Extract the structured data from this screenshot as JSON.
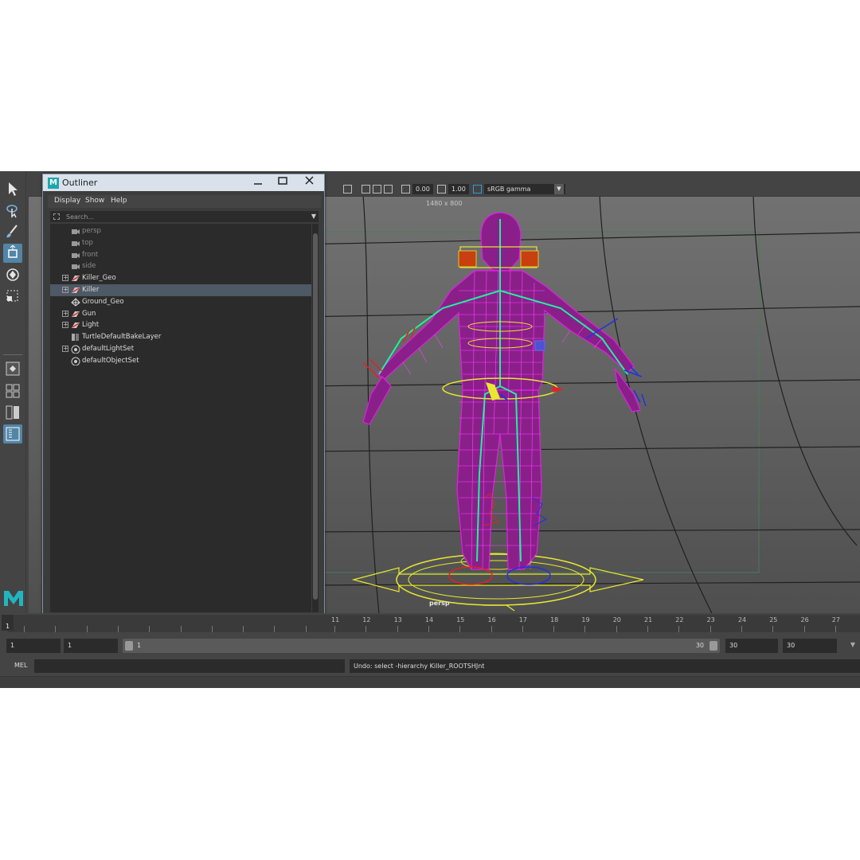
{
  "viewport": {
    "resolution_gate": "1480 x 800",
    "camera_name": "persp",
    "exposure": "0.00",
    "gamma": "1.00",
    "color_space": "sRGB gamma"
  },
  "outliner": {
    "title": "Outliner",
    "menu": [
      "Display",
      "Show",
      "Help"
    ],
    "search_placeholder": "Search...",
    "items": [
      {
        "label": "persp",
        "icon": "camera-icon",
        "expandable": false,
        "dim": true
      },
      {
        "label": "top",
        "icon": "camera-icon",
        "expandable": false,
        "dim": true
      },
      {
        "label": "front",
        "icon": "camera-icon",
        "expandable": false,
        "dim": true
      },
      {
        "label": "side",
        "icon": "camera-icon",
        "expandable": false,
        "dim": true
      },
      {
        "label": "Killer_Geo",
        "icon": "group-icon",
        "expandable": true,
        "dim": false
      },
      {
        "label": "Killer",
        "icon": "group-icon",
        "expandable": true,
        "dim": false,
        "selected": true
      },
      {
        "label": "Ground_Geo",
        "icon": "mesh-icon",
        "expandable": false,
        "dim": false
      },
      {
        "label": "Gun",
        "icon": "group-icon",
        "expandable": true,
        "dim": false
      },
      {
        "label": "Light",
        "icon": "group-icon",
        "expandable": true,
        "dim": false
      },
      {
        "label": "TurtleDefaultBakeLayer",
        "icon": "bake-layer-icon",
        "expandable": false,
        "dim": false
      },
      {
        "label": "defaultLightSet",
        "icon": "set-icon",
        "expandable": true,
        "dim": false
      },
      {
        "label": "defaultObjectSet",
        "icon": "set-icon",
        "expandable": false,
        "dim": false
      }
    ]
  },
  "timeslider": {
    "current_frame": "1",
    "visible_ticks": [
      "11",
      "12",
      "13",
      "14",
      "15",
      "16",
      "17",
      "18",
      "19",
      "20",
      "21",
      "22",
      "23",
      "24",
      "25",
      "26",
      "27"
    ]
  },
  "range_slider": {
    "anim_start": "1",
    "playback_start": "1",
    "range_start": "1",
    "range_end": "30",
    "playback_end": "30",
    "anim_end": "30"
  },
  "command_line": {
    "label": "MEL",
    "input_value": "",
    "result": "Undo: select -hierarchy Killer_ROOTSHJnt"
  },
  "colors": {
    "ui_bg": "#444444",
    "field_bg": "#2b2b2b",
    "active_tool": "#5285a6",
    "wireframe": "#e020e0",
    "skeleton": "#20f0a0"
  }
}
